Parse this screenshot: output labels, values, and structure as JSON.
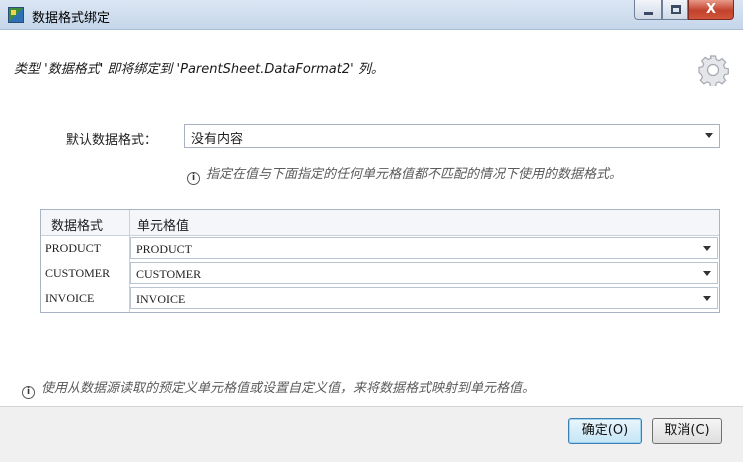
{
  "window": {
    "title": "数据格式绑定"
  },
  "header": {
    "message": "类型 '数据格式' 即将绑定到 'ParentSheet.DataFormat2' 列。"
  },
  "default_format": {
    "label": "默认数据格式：",
    "value": "没有内容",
    "hint": "指定在值与下面指定的任何单元格值都不匹配的情况下使用的数据格式。"
  },
  "grid": {
    "headers": [
      "数据格式",
      "单元格值"
    ],
    "rows": [
      {
        "key": "PRODUCT",
        "value": "PRODUCT"
      },
      {
        "key": "CUSTOMER",
        "value": "CUSTOMER"
      },
      {
        "key": "INVOICE",
        "value": "INVOICE"
      }
    ]
  },
  "footer": {
    "hint": "使用从数据源读取的预定义单元格值或设置自定义值，来将数据格式映射到单元格值。"
  },
  "buttons": {
    "ok": "确定(O)",
    "cancel": "取消(C)"
  },
  "icons": {
    "info": "i",
    "close": "X"
  }
}
